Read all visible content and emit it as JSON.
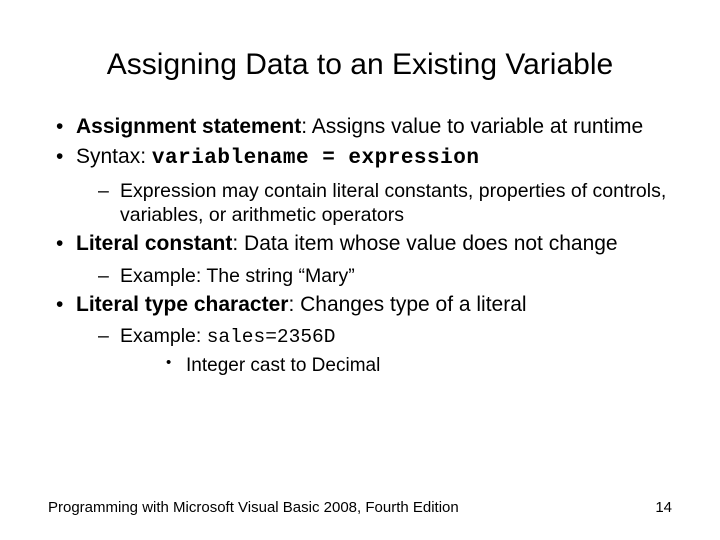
{
  "title": "Assigning Data to an Existing Variable",
  "b1": {
    "term": "Assignment statement",
    "desc": ": Assigns value to variable at runtime"
  },
  "b2": {
    "prefix": "Syntax: ",
    "code": "variablename = expression",
    "s1": "Expression may contain literal constants, properties of controls, variables, or arithmetic operators"
  },
  "b3": {
    "term": "Literal constant",
    "desc": ": Data item whose value does not change",
    "s1": "Example: The string “Mary”"
  },
  "b4": {
    "term": "Literal type character",
    "desc": ": Changes type of a literal",
    "s1_prefix": "Example: ",
    "s1_code": "sales=2356D",
    "s2": "Integer cast to Decimal"
  },
  "footer": {
    "book": "Programming with Microsoft Visual Basic 2008, Fourth Edition",
    "page": "14"
  }
}
